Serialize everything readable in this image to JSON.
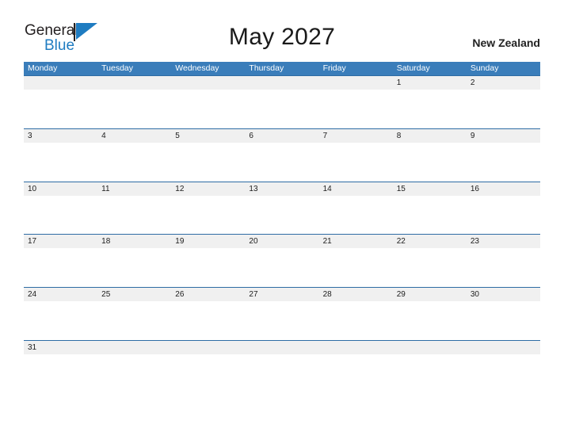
{
  "brand": {
    "name_part1": "General",
    "name_part2": "Blue",
    "flag_icon": "blue-triangle-flag-icon",
    "color_primary": "#1f7cc1",
    "color_text": "#231f20"
  },
  "header": {
    "title": "May 2027",
    "region": "New Zealand"
  },
  "calendar": {
    "month": "May",
    "year": "2027",
    "accent_color": "#3a7dba",
    "row_divider_color": "#2e6ca4",
    "date_band_color": "#f0f0f0",
    "weekday_headers": [
      "Monday",
      "Tuesday",
      "Wednesday",
      "Thursday",
      "Friday",
      "Saturday",
      "Sunday"
    ],
    "weeks": [
      {
        "days": [
          "",
          "",
          "",
          "",
          "",
          "1",
          "2"
        ]
      },
      {
        "days": [
          "3",
          "4",
          "5",
          "6",
          "7",
          "8",
          "9"
        ]
      },
      {
        "days": [
          "10",
          "11",
          "12",
          "13",
          "14",
          "15",
          "16"
        ]
      },
      {
        "days": [
          "17",
          "18",
          "19",
          "20",
          "21",
          "22",
          "23"
        ]
      },
      {
        "days": [
          "24",
          "25",
          "26",
          "27",
          "28",
          "29",
          "30"
        ]
      },
      {
        "days": [
          "31",
          "",
          "",
          "",
          "",
          "",
          ""
        ]
      }
    ]
  }
}
